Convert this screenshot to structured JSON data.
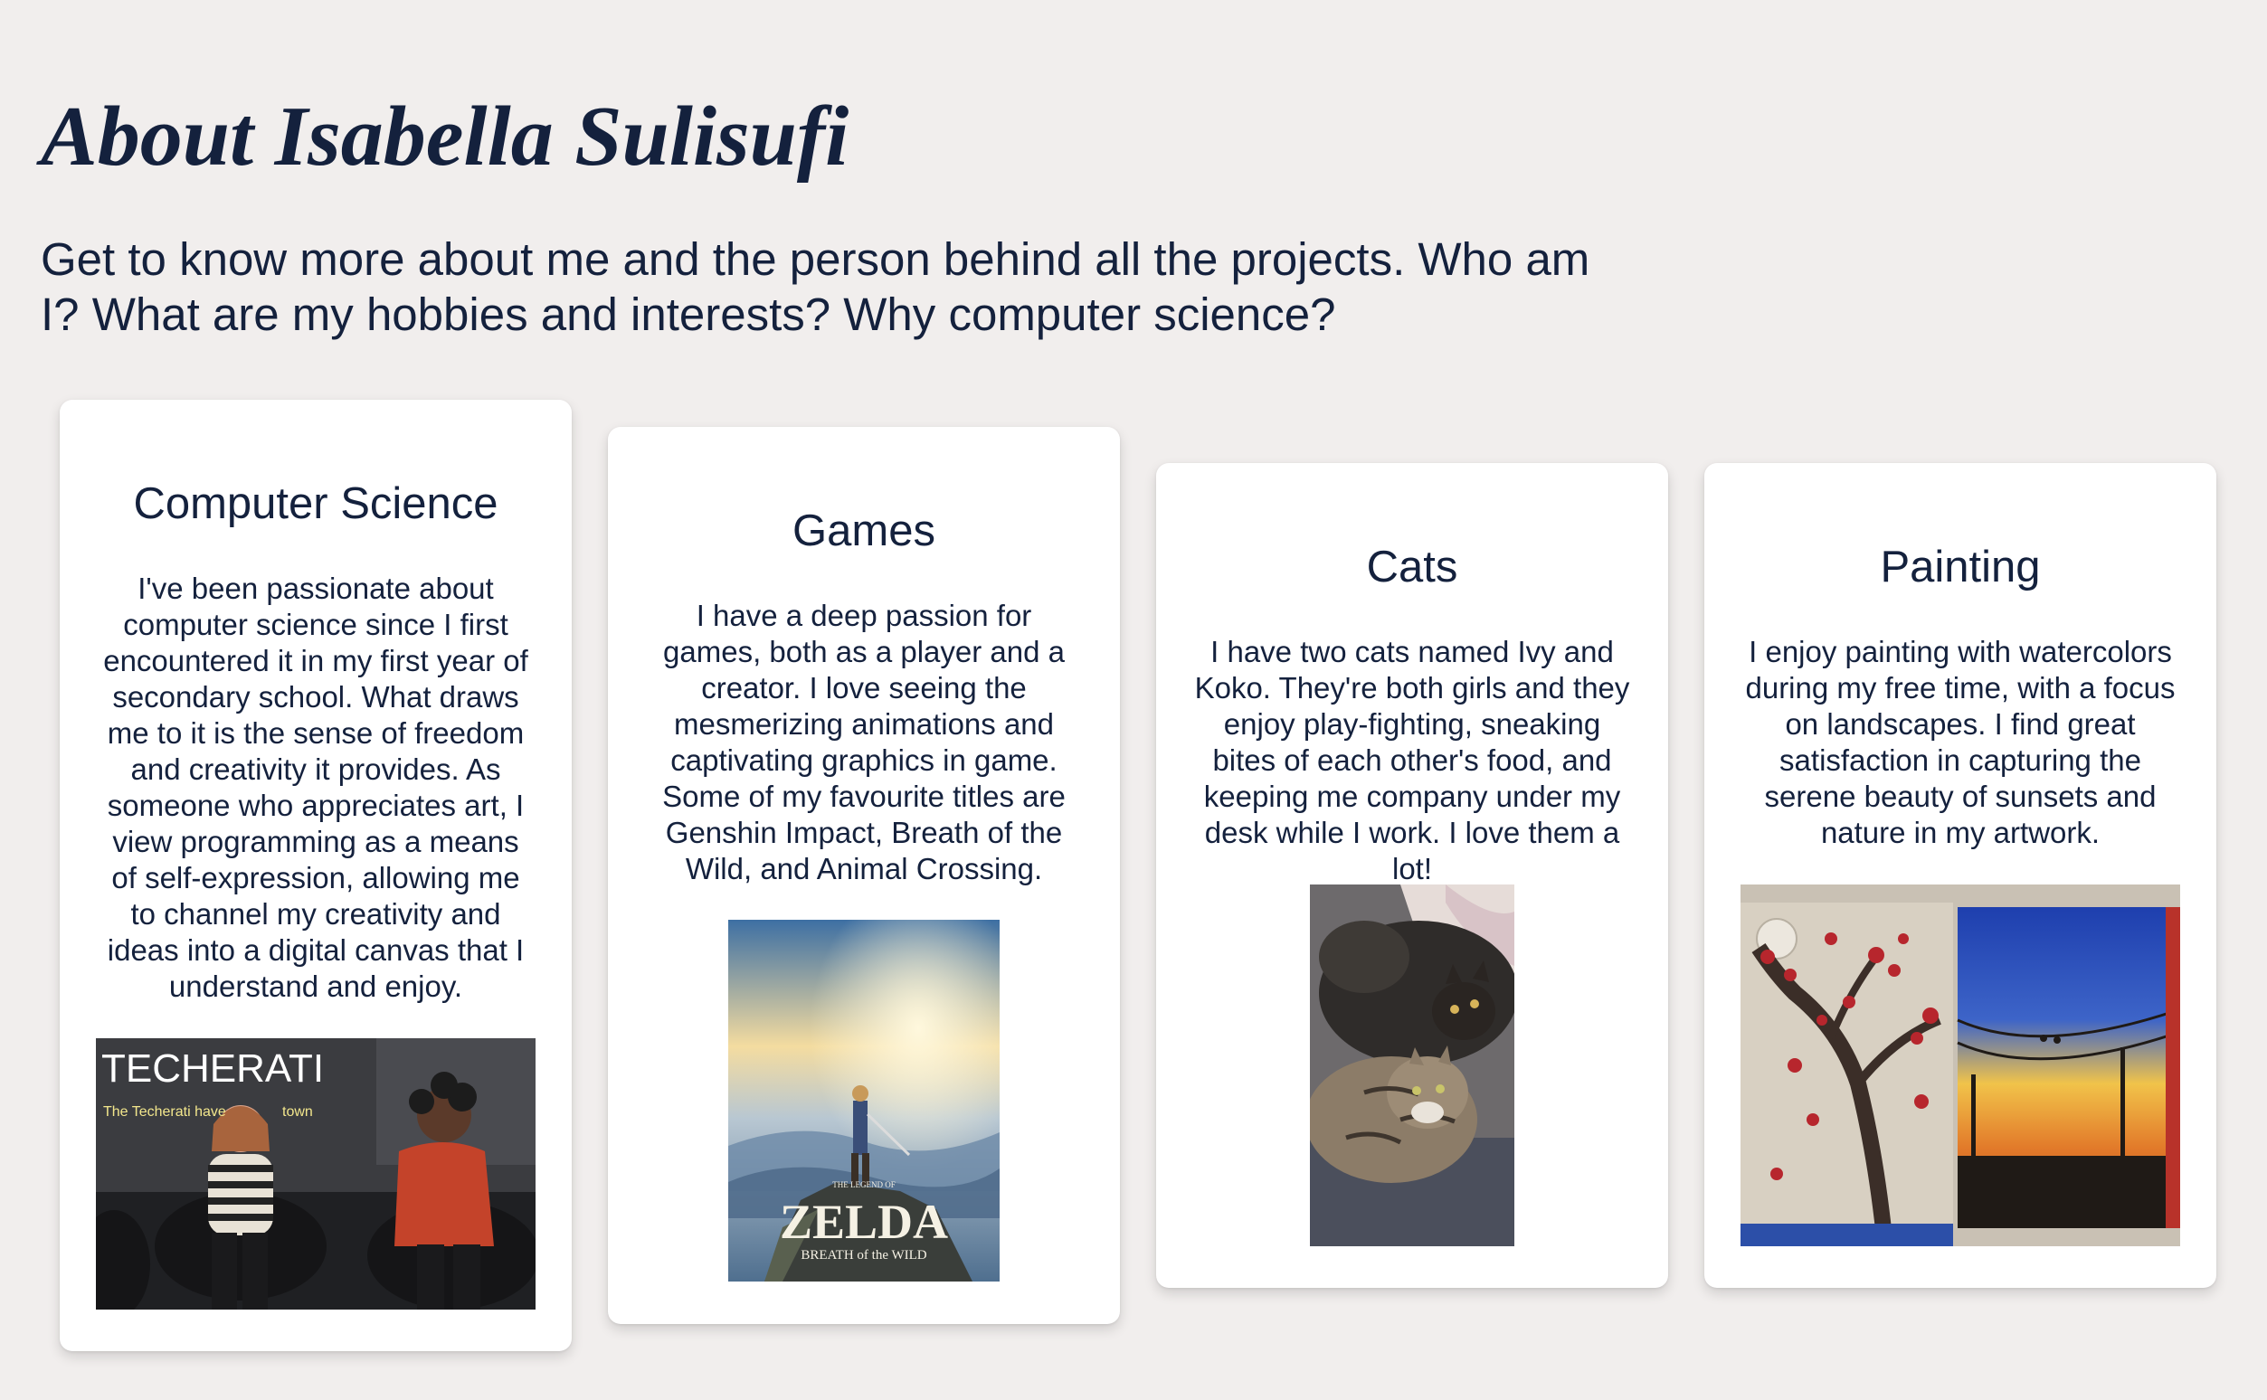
{
  "header": {
    "title": "About Isabella Sulisufi",
    "intro": "Get to know more about me and the person behind all the projects. Who am I? What are my hobbies and interests? Why computer science?"
  },
  "cards": [
    {
      "title": "Computer Science",
      "text": "I've been passionate about computer science since I first encountered it in my first year of secondary school. What draws me to it is the sense of freedom and creativity it provides. As someone who appreciates art, I view programming as a means of self-expression, allowing me to channel my creativity and ideas into a digital canvas that I understand and enjoy.",
      "image": {
        "logo_text": "TECHERATI",
        "caption_text": "The Techerati have",
        "caption_text_2": "town"
      }
    },
    {
      "title": "Games",
      "text": "I have a deep passion for games, both as a player and a creator. I love seeing the mesmerizing animations and captivating graphics in game. Some of my favourite titles are Genshin Impact, Breath of the Wild, and Animal Crossing.",
      "image": {
        "small_text": "THE LEGEND OF",
        "logo_text": "ZELDA",
        "sub_text": "BREATH of the WILD"
      }
    },
    {
      "title": "Cats",
      "text": "I have two cats named Ivy and Koko. They're both girls and they enjoy play-fighting, sneaking bites of each other's food, and keeping me company under my desk while I work. I love them a lot!"
    },
    {
      "title": "Painting",
      "text": "I enjoy painting with watercolors during my free time, with a focus on landscapes. I find great satisfaction in capturing the serene beauty of sunsets and nature in my artwork."
    }
  ],
  "colors": {
    "background": "#f1eeed",
    "text": "#14213d",
    "card": "#ffffff"
  }
}
